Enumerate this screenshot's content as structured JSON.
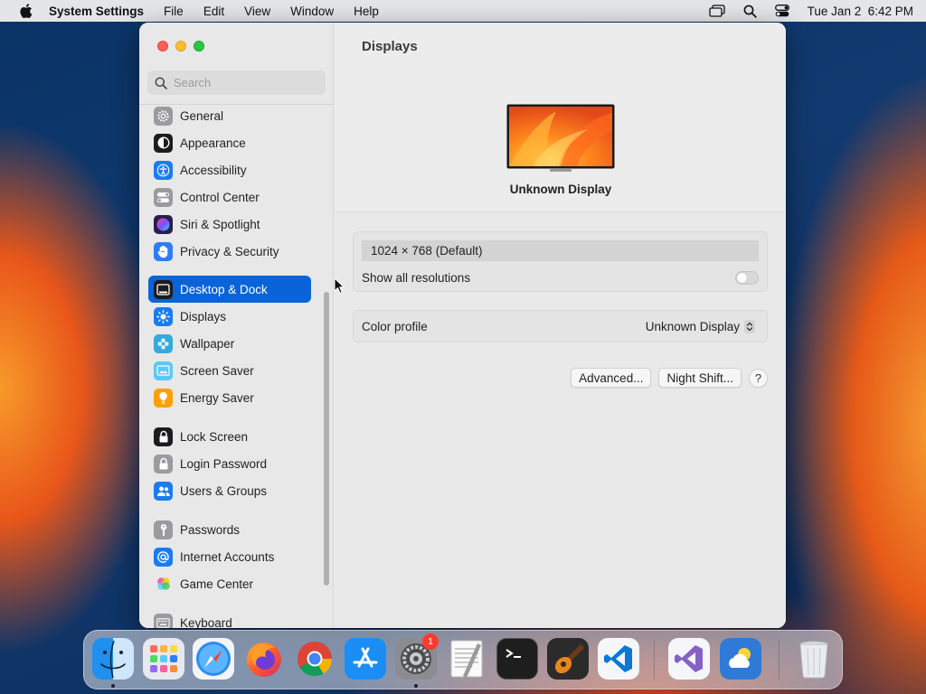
{
  "menubar": {
    "app_name": "System Settings",
    "items": [
      "File",
      "Edit",
      "View",
      "Window",
      "Help"
    ],
    "clock": "Tue Jan 2  6:42 PM"
  },
  "sidebar": {
    "search_placeholder": "Search",
    "items": [
      {
        "label": "General",
        "icon": "gear-icon",
        "color": "#8e8e93"
      },
      {
        "label": "Appearance",
        "icon": "appearance-icon",
        "color": "#1c1c1e"
      },
      {
        "label": "Accessibility",
        "icon": "accessibility-icon",
        "color": "#1a7cf0"
      },
      {
        "label": "Control Center",
        "icon": "control-center-icon",
        "color": "#8e8e93"
      },
      {
        "label": "Siri & Spotlight",
        "icon": "siri-icon",
        "color": "#5b3fd6"
      },
      {
        "label": "Privacy & Security",
        "icon": "hand-icon",
        "color": "#2f7cf6"
      },
      {
        "label": "Desktop & Dock",
        "icon": "dock-icon",
        "color": "#1c1c1e",
        "active": true
      },
      {
        "label": "Displays",
        "icon": "sun-icon",
        "color": "#1a7cf0"
      },
      {
        "label": "Wallpaper",
        "icon": "flower-icon",
        "color": "#34aadc"
      },
      {
        "label": "Screen Saver",
        "icon": "screen-saver-icon",
        "color": "#5ac8fa"
      },
      {
        "label": "Energy Saver",
        "icon": "bulb-icon",
        "color": "#ff9f0a"
      },
      {
        "label": "Lock Screen",
        "icon": "lock-icon",
        "color": "#1c1c1e"
      },
      {
        "label": "Login Password",
        "icon": "padlock-icon",
        "color": "#8e8e93"
      },
      {
        "label": "Users & Groups",
        "icon": "users-icon",
        "color": "#1a7cf0"
      },
      {
        "label": "Passwords",
        "icon": "key-icon",
        "color": "#8e8e93"
      },
      {
        "label": "Internet Accounts",
        "icon": "at-icon",
        "color": "#1a7cf0"
      },
      {
        "label": "Game Center",
        "icon": "game-center-icon",
        "color": "#ffffff"
      },
      {
        "label": "Keyboard",
        "icon": "keyboard-icon",
        "color": "#8e8e93"
      }
    ]
  },
  "main": {
    "title": "Displays",
    "display_name": "Unknown Display",
    "resolution": "1024 × 768 (Default)",
    "show_all_label": "Show all resolutions",
    "show_all_on": false,
    "color_profile_label": "Color profile",
    "color_profile_value": "Unknown Display",
    "advanced_label": "Advanced...",
    "night_shift_label": "Night Shift...",
    "help_label": "?"
  },
  "dock": {
    "apps": [
      {
        "name": "finder-icon",
        "running": true
      },
      {
        "name": "launchpad-icon",
        "running": false
      },
      {
        "name": "safari-icon",
        "running": false
      },
      {
        "name": "firefox-icon",
        "running": false
      },
      {
        "name": "chrome-icon",
        "running": false
      },
      {
        "name": "app-store-icon",
        "running": false
      },
      {
        "name": "system-settings-icon",
        "running": true,
        "badge": "1"
      },
      {
        "name": "textedit-icon",
        "running": false
      },
      {
        "name": "terminal-icon",
        "running": false
      },
      {
        "name": "garageband-icon",
        "running": false
      },
      {
        "name": "vscode-icon",
        "running": false
      },
      {
        "name": "visual-studio-icon",
        "running": false
      },
      {
        "name": "weather-icon",
        "running": false
      },
      {
        "name": "trash-icon",
        "running": false
      }
    ]
  },
  "colors": {
    "accent": "#0a63d8",
    "close": "#ff5f57",
    "minimize": "#febc2e",
    "zoom": "#28c840"
  }
}
